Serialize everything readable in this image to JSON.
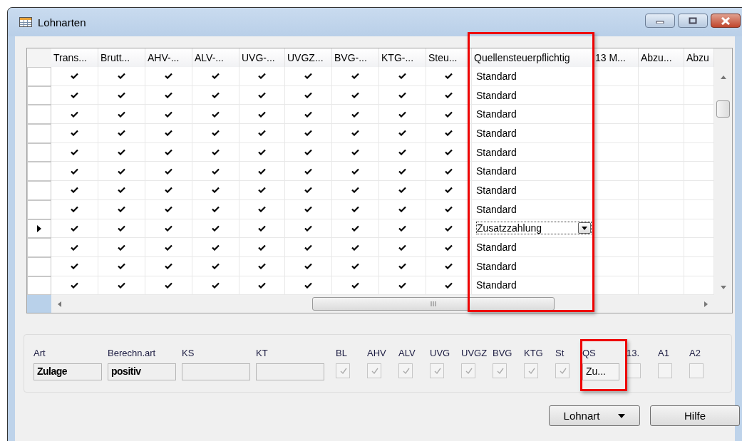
{
  "window": {
    "title": "Lohnarten"
  },
  "table": {
    "columns": [
      "Trans...",
      "Brutt...",
      "AHV-...",
      "ALV-...",
      "UVG-...",
      "UVGZ...",
      "BVG-...",
      "KTG-...",
      "Steu...",
      "Quellensteuerpflichtig",
      "13 M...",
      "Abzu...",
      "Abzu"
    ],
    "rows": [
      {
        "selected": false,
        "checks": [
          true,
          true,
          true,
          true,
          true,
          true,
          true,
          true,
          true
        ],
        "qs": "Standard"
      },
      {
        "selected": false,
        "checks": [
          true,
          true,
          true,
          true,
          true,
          true,
          true,
          true,
          true
        ],
        "qs": "Standard"
      },
      {
        "selected": false,
        "checks": [
          true,
          true,
          true,
          true,
          true,
          true,
          true,
          true,
          true
        ],
        "qs": "Standard"
      },
      {
        "selected": false,
        "checks": [
          true,
          true,
          true,
          true,
          true,
          true,
          true,
          true,
          true
        ],
        "qs": "Standard"
      },
      {
        "selected": false,
        "checks": [
          true,
          true,
          true,
          true,
          true,
          true,
          true,
          true,
          true
        ],
        "qs": "Standard"
      },
      {
        "selected": false,
        "checks": [
          true,
          true,
          true,
          true,
          true,
          true,
          true,
          true,
          true
        ],
        "qs": "Standard"
      },
      {
        "selected": false,
        "checks": [
          true,
          true,
          true,
          true,
          true,
          true,
          true,
          true,
          true
        ],
        "qs": "Standard"
      },
      {
        "selected": false,
        "checks": [
          true,
          true,
          true,
          true,
          true,
          true,
          true,
          true,
          true
        ],
        "qs": "Standard"
      },
      {
        "selected": true,
        "checks": [
          true,
          true,
          true,
          true,
          true,
          true,
          true,
          true,
          true
        ],
        "qs": "Zusatzzahlung"
      },
      {
        "selected": false,
        "checks": [
          true,
          true,
          true,
          true,
          true,
          true,
          true,
          true,
          true
        ],
        "qs": "Standard"
      },
      {
        "selected": false,
        "checks": [
          true,
          true,
          true,
          true,
          true,
          true,
          true,
          true,
          true
        ],
        "qs": "Standard"
      },
      {
        "selected": false,
        "checks": [
          true,
          true,
          true,
          true,
          true,
          true,
          true,
          true,
          true
        ],
        "qs": "Standard"
      }
    ]
  },
  "details": [
    {
      "kind": "text",
      "label": "Art",
      "value": "Zulage"
    },
    {
      "kind": "text",
      "label": "Berechn.art",
      "value": "positiv"
    },
    {
      "kind": "text",
      "label": "KS"
    },
    {
      "kind": "text",
      "label": "KT"
    },
    {
      "kind": "check",
      "label": "BL",
      "checked": true
    },
    {
      "kind": "check",
      "label": "AHV",
      "checked": true
    },
    {
      "kind": "check",
      "label": "ALV",
      "checked": true
    },
    {
      "kind": "check",
      "label": "UVG",
      "checked": true
    },
    {
      "kind": "check",
      "label": "UVGZ",
      "checked": true
    },
    {
      "kind": "check",
      "label": "BVG",
      "checked": true
    },
    {
      "kind": "check",
      "label": "KTG",
      "checked": true
    },
    {
      "kind": "check",
      "label": "St",
      "checked": true
    },
    {
      "kind": "combo",
      "label": "QS",
      "value": "Zu..."
    },
    {
      "kind": "check",
      "label": "13.",
      "checked": false
    },
    {
      "kind": "check",
      "label": "A1",
      "checked": false
    },
    {
      "kind": "check",
      "label": "A2",
      "checked": false
    }
  ],
  "buttons": [
    {
      "kind": "menu",
      "label": "Lohnart"
    },
    {
      "kind": "plain",
      "label": "Hilfe"
    }
  ]
}
